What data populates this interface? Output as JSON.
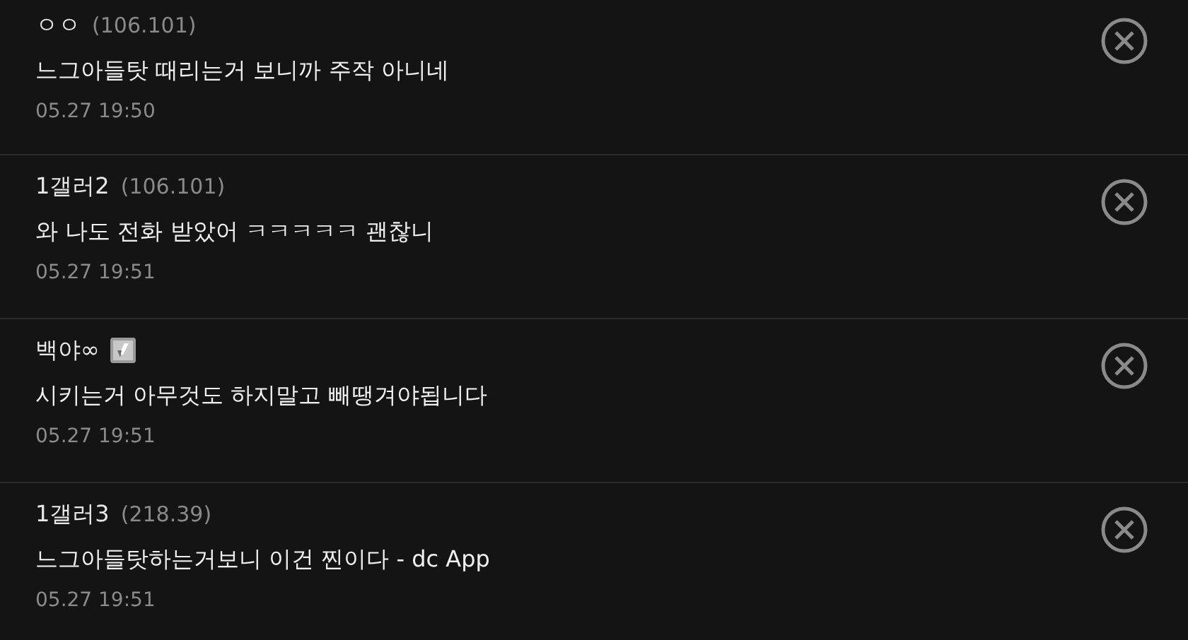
{
  "comments": [
    {
      "author": "ㅇㅇ",
      "ip": "(106.101)",
      "badge": false,
      "text": "느그아들탓 때리는거 보니까 주작 아니네",
      "time": "05.27 19:50"
    },
    {
      "author": "1갤러2",
      "ip": "(106.101)",
      "badge": false,
      "text": "와 나도 전화 받았어 ㅋㅋㅋㅋㅋ 괜찮니",
      "time": "05.27 19:51"
    },
    {
      "author": "백야∞",
      "badge": true,
      "text": "시키는거 아무것도 하지말고 빼땡겨야됩니다",
      "time": "05.27 19:51"
    },
    {
      "author": "1갤러3",
      "ip": "(218.39)",
      "badge": false,
      "text": "느그아들탓하는거보니 이건 찐이다 - dc App",
      "time": "05.27 19:51"
    }
  ]
}
